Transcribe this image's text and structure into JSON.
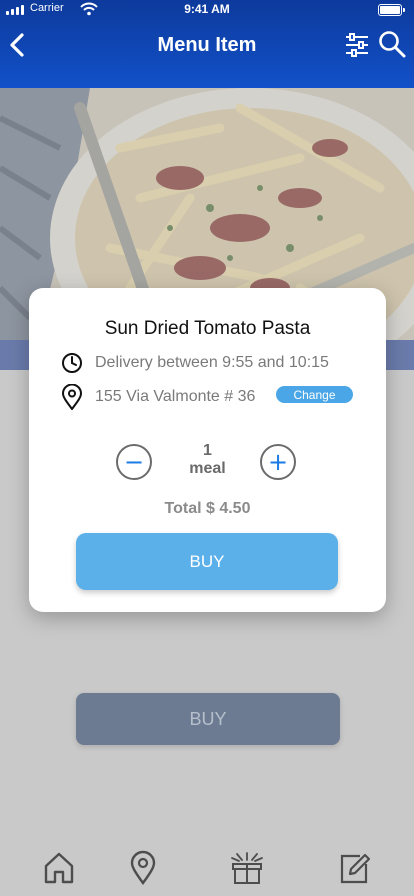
{
  "status_bar": {
    "carrier": "Carrier",
    "time": "9:41 AM"
  },
  "header": {
    "title": "Menu Item",
    "back_icon": "chevron-left-icon",
    "filter_icon": "sliders-icon",
    "search_icon": "search-icon"
  },
  "background": {
    "buy_label": "BUY"
  },
  "modal": {
    "item_name": "Sun Dried Tomato Pasta",
    "delivery_text": "Delivery between 9:55  and 10:15",
    "address_text": "155 Via Valmonte # 36",
    "change_label": "Change",
    "quantity": "1",
    "quantity_unit": "meal",
    "decrement_label": "−",
    "increment_label": "+",
    "total_text": "Total $ 4.50",
    "buy_label": "BUY"
  },
  "tabbar": {
    "items": [
      {
        "icon": "home-icon"
      },
      {
        "icon": "location-pin-icon"
      },
      {
        "icon": "gift-icon"
      },
      {
        "icon": "edit-icon"
      }
    ]
  },
  "colors": {
    "header": "#1251c9",
    "accent": "#5bb0ea",
    "change_badge": "#4aa6e6",
    "stepper_symbol": "#1a7be6"
  }
}
